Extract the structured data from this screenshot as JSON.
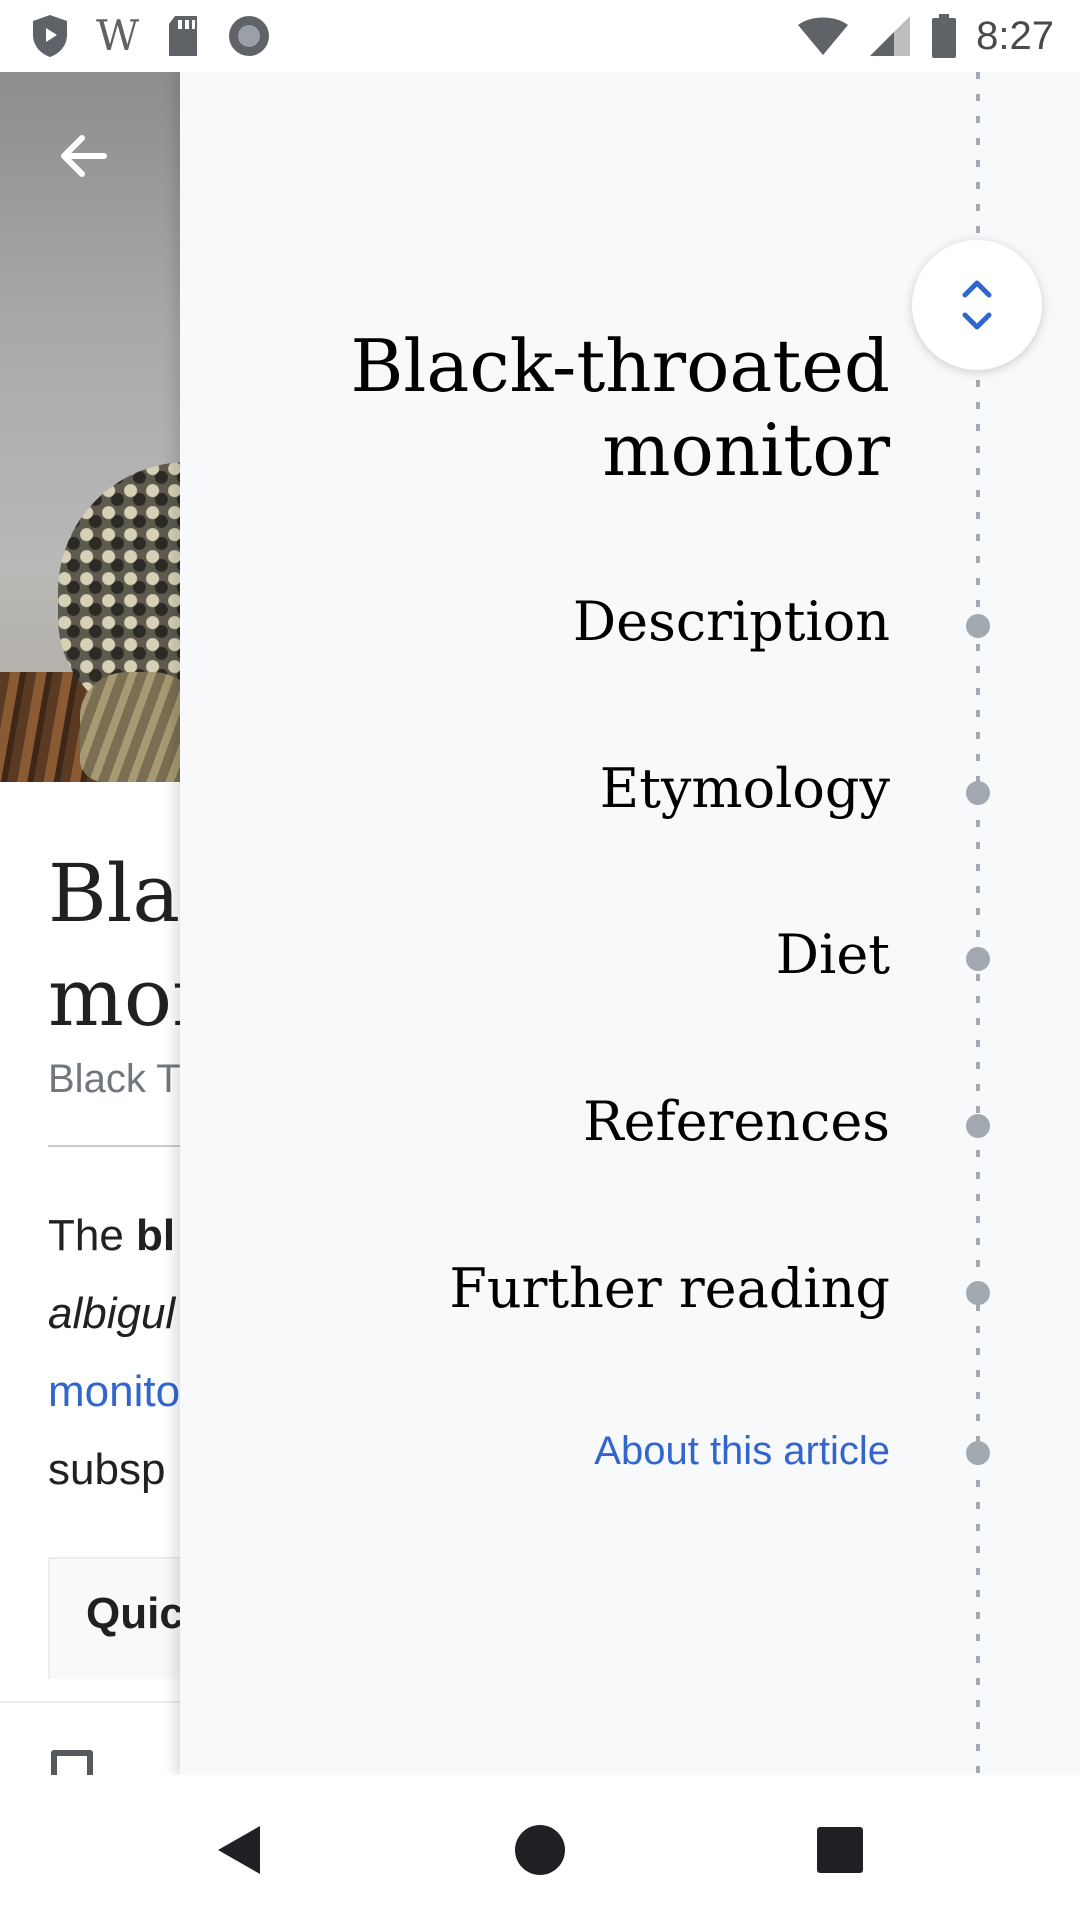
{
  "status_bar": {
    "time": "8:27",
    "left_icons": [
      "shield-play-icon",
      "wikipedia-w-icon",
      "sd-card-icon",
      "circle-record-icon"
    ],
    "wiki_glyph": "W",
    "right_icons": [
      "wifi-icon",
      "signal-icon",
      "battery-icon"
    ]
  },
  "article": {
    "title": "Black-throated\nmonitor",
    "subtitle": "Black Throated Monitor",
    "body_bold": "bl",
    "body_prefix": "The ",
    "body_italic": "albigul",
    "body_link": "monito",
    "body_tail": "subsp",
    "quick_facts_label": "Quic"
  },
  "toc": {
    "title": "Black-throated monitor",
    "items": [
      {
        "label": "Description"
      },
      {
        "label": "Etymology"
      },
      {
        "label": "Diet"
      },
      {
        "label": "References"
      },
      {
        "label": "Further reading"
      }
    ],
    "about_label": "About this article"
  },
  "colors": {
    "link": "#3366cc",
    "drawer_bg": "#f8f9fa",
    "dot": "#a2a9b1"
  }
}
